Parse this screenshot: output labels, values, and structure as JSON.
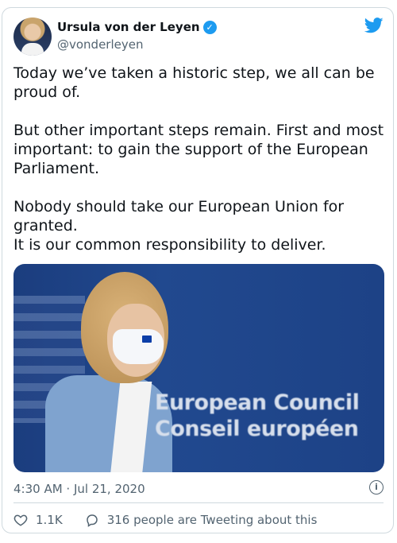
{
  "author": {
    "name": "Ursula von der Leyen",
    "handle": "@vonderleyen",
    "verified_icon": "verified-badge-icon"
  },
  "tweet": {
    "text": "Today we’ve taken a historic step, we all can be proud of.\n\nBut other important steps remain. First and most important: to gain the support of the European Parliament.\n\nNobody should take our European Union for granted.\nIt is our common responsibility to deliver.",
    "media": {
      "sign_line1": "European Council",
      "sign_line2": "Conseil européen"
    },
    "timestamp": "4:30 AM · Jul 21, 2020"
  },
  "actions": {
    "likes": "1.1K",
    "conversation": "316 people are Tweeting about this"
  },
  "colors": {
    "brand_blue": "#1d9bf0",
    "text_secondary": "#536471",
    "border": "#cfd9de"
  }
}
